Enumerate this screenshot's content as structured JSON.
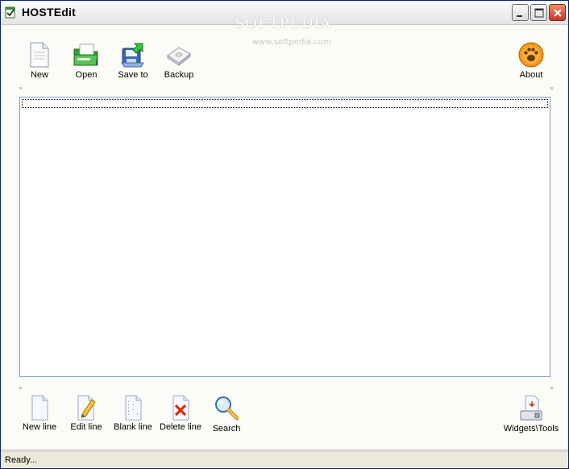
{
  "window": {
    "title": "HOSTEdit",
    "watermark": "SOFTPEDIA",
    "watermark_sub": "www.softpedia.com"
  },
  "toolbar_top": {
    "new": "New",
    "open": "Open",
    "save_to": "Save to",
    "backup": "Backup",
    "about": "About"
  },
  "toolbar_bottom": {
    "new_line": "New line",
    "edit_line": "Edit line",
    "blank_line": "Blank line",
    "delete_line": "Delete line",
    "search": "Search",
    "widgets_tools": "Widgets\\Tools"
  },
  "status": {
    "text": "Ready..."
  },
  "icons": {
    "new": "document-icon",
    "open": "folder-open-icon",
    "save_to": "save-to-icon",
    "backup": "backup-disk-icon",
    "about": "paw-icon",
    "new_line": "blank-page-icon",
    "edit_line": "pencil-page-icon",
    "blank_line": "numbered-page-icon",
    "delete_line": "delete-page-icon",
    "search": "magnifier-icon",
    "widgets_tools": "tools-icon"
  }
}
